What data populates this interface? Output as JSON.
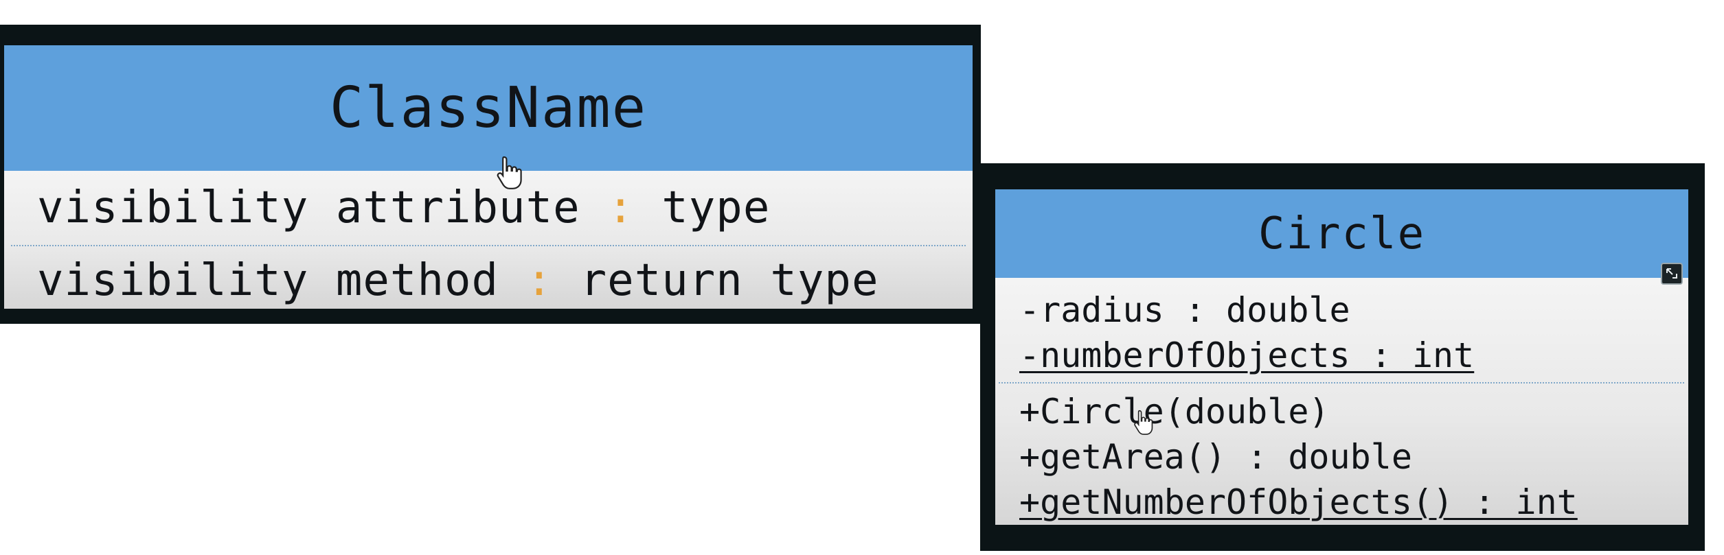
{
  "template_card": {
    "title": "ClassName",
    "attribute_row": {
      "visibility": "visibility",
      "name": "attribute",
      "separator": ":",
      "type": "type"
    },
    "method_row": {
      "visibility": "visibility",
      "name": "method",
      "separator": ":",
      "type": "return type"
    }
  },
  "circle_card": {
    "title": "Circle",
    "attributes": [
      {
        "text": "-radius : double",
        "static": false
      },
      {
        "text": "-numberOfObjects : int",
        "static": true
      }
    ],
    "methods": [
      {
        "text": "+Circle(double)",
        "static": false
      },
      {
        "text": "+getArea() : double",
        "static": false
      },
      {
        "text": "+getNumberOfObjects() : int",
        "static": true
      }
    ]
  },
  "colors": {
    "header_blue": "#5ea0dc",
    "frame_dark": "#0b1416",
    "separator_orange": "#e6a23c",
    "body_gray": "#e9e9e9"
  },
  "icons": {
    "pointer": "hand-pointer-cursor-icon",
    "corner": "expand-icon"
  }
}
